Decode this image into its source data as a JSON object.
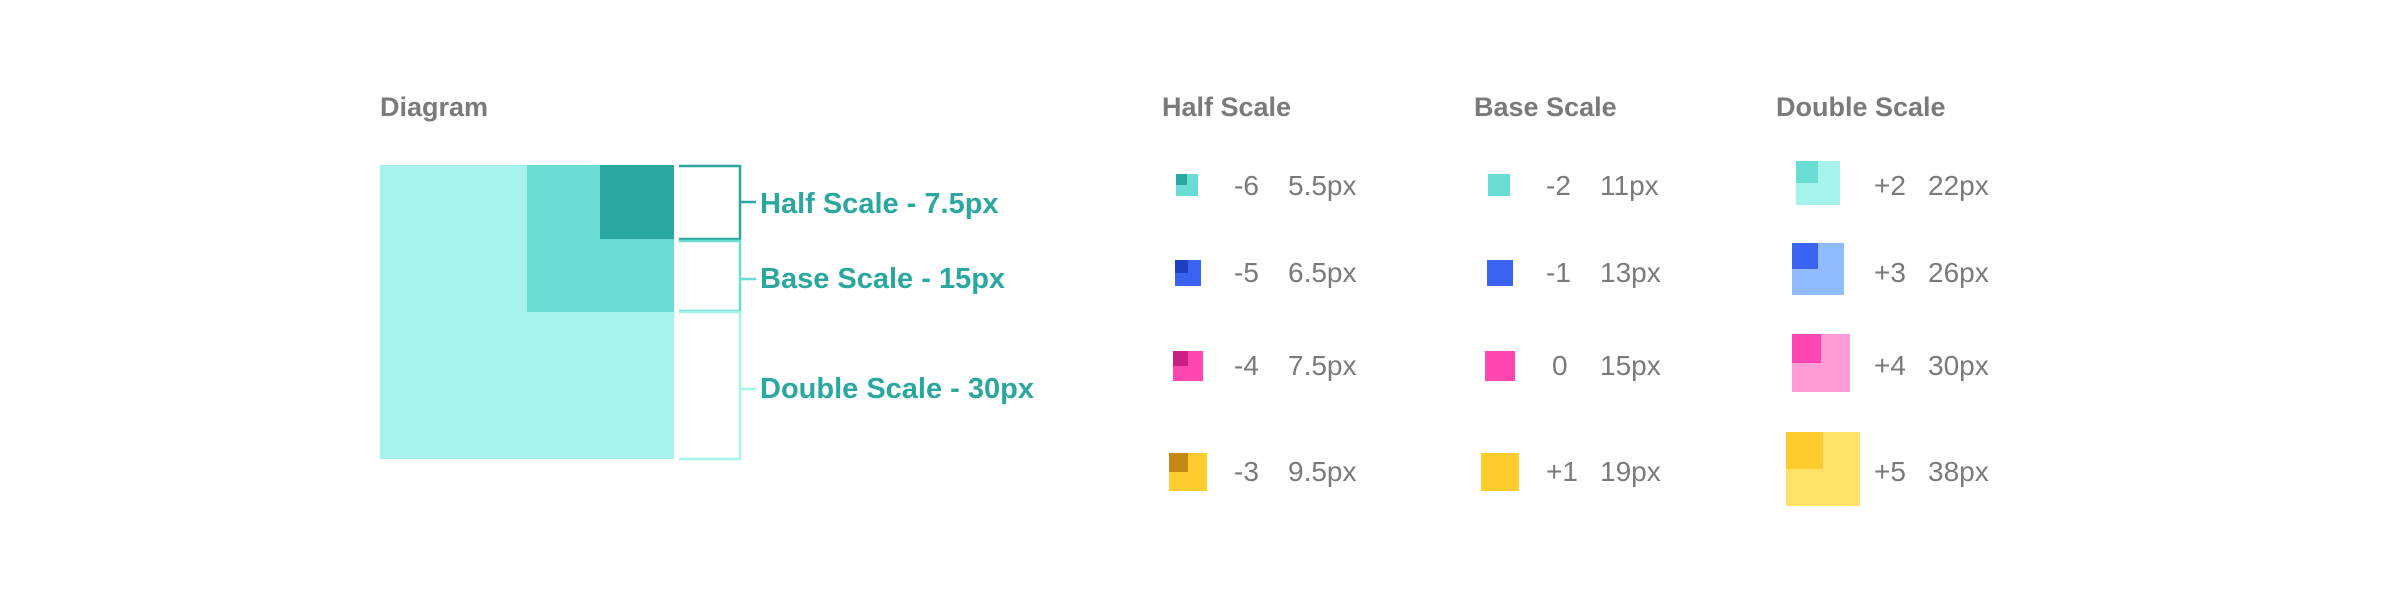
{
  "headings": {
    "diagram": "Diagram",
    "half": "Half Scale",
    "base": "Base Scale",
    "double": "Double Scale"
  },
  "diagram": {
    "callouts": {
      "half": "Half Scale - 7.5px",
      "base": "Base Scale - 15px",
      "double": "Double Scale - 30px"
    },
    "colors": {
      "double": "#a5f3eb",
      "base": "#69ddd4",
      "half": "#2aa79e",
      "callout_text": "#2aa79e"
    }
  },
  "colors": {
    "teal": {
      "light": "#a5f3eb",
      "mid": "#69ddd4",
      "dark": "#2aa79e"
    },
    "blue": {
      "light": "#8fbcff",
      "mid": "#3b63f2",
      "dark": "#1e3fbf"
    },
    "pink": {
      "light": "#ff9bd6",
      "mid": "#ff45b0",
      "dark": "#cc1f85"
    },
    "yellow": {
      "light": "#ffe169",
      "mid": "#ffcc2e",
      "dark": "#c28a14"
    }
  },
  "half_scale": [
    {
      "step": "-6",
      "size": "5.5px",
      "color": "teal"
    },
    {
      "step": "-5",
      "size": "6.5px",
      "color": "blue"
    },
    {
      "step": "-4",
      "size": "7.5px",
      "color": "pink"
    },
    {
      "step": "-3",
      "size": "9.5px",
      "color": "yellow"
    }
  ],
  "base_scale": [
    {
      "step": "-2",
      "size": "11px",
      "color": "teal"
    },
    {
      "step": "-1",
      "size": "13px",
      "color": "blue"
    },
    {
      "step": "0",
      "size": "15px",
      "color": "pink"
    },
    {
      "step": "+1",
      "size": "19px",
      "color": "yellow"
    }
  ],
  "double_scale": [
    {
      "step": "+2",
      "size": "22px",
      "color": "teal"
    },
    {
      "step": "+3",
      "size": "26px",
      "color": "blue"
    },
    {
      "step": "+4",
      "size": "30px",
      "color": "pink"
    },
    {
      "step": "+5",
      "size": "38px",
      "color": "yellow"
    }
  ]
}
